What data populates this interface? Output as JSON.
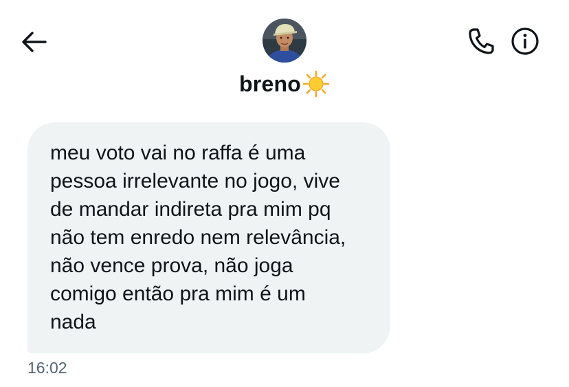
{
  "header": {
    "back_icon": "arrow-left-icon",
    "avatar_icon": "profile-avatar",
    "contact_name": "breno",
    "name_emoji": "sun-emoji",
    "call_icon": "phone-icon",
    "info_icon": "info-icon"
  },
  "message": {
    "lines": [
      "meu voto vai no raffa é uma",
      "pessoa irrelevante no jogo, vive",
      "de mandar indireta pra mim pq",
      "não tem enredo nem relevância,",
      "não vence prova, não joga",
      "comigo então pra mim é um",
      "nada"
    ],
    "timestamp": "16:02"
  },
  "colors": {
    "bubble": "#eff3f4",
    "text": "#0f1419",
    "muted": "#536471",
    "background": "#ffffff"
  }
}
